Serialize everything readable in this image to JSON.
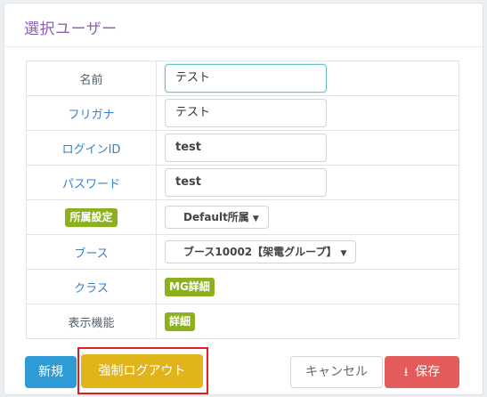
{
  "header": {
    "title": "選択ユーザー"
  },
  "form": {
    "name": {
      "label": "名前",
      "value": "テスト"
    },
    "furigana": {
      "label": "フリガナ",
      "value": "テスト"
    },
    "login_id": {
      "label": "ログインID",
      "value": "test"
    },
    "password": {
      "label": "パスワード",
      "value": "test"
    },
    "affiliation": {
      "label": "所属設定",
      "value": "Default所属"
    },
    "booth": {
      "label": "ブース",
      "value": "ブース10002【架電グループ】"
    },
    "class": {
      "label": "クラス",
      "value": "MG詳細"
    },
    "display": {
      "label": "表示機能",
      "value": "詳細"
    }
  },
  "footer": {
    "new_label": "新規",
    "logout_label": "強制ログアウト",
    "cancel_label": "キャンセル",
    "save_label": "保存"
  },
  "colors": {
    "title": "#8e5fb6",
    "label": "#3a7fc5",
    "badge": "#8db01f",
    "new": "#2e9bd6",
    "logout": "#e1b41c",
    "save": "#e45b5b",
    "highlight": "#e02020"
  },
  "icons": {
    "save": "download-icon",
    "dropdown": "caret-down-icon"
  }
}
